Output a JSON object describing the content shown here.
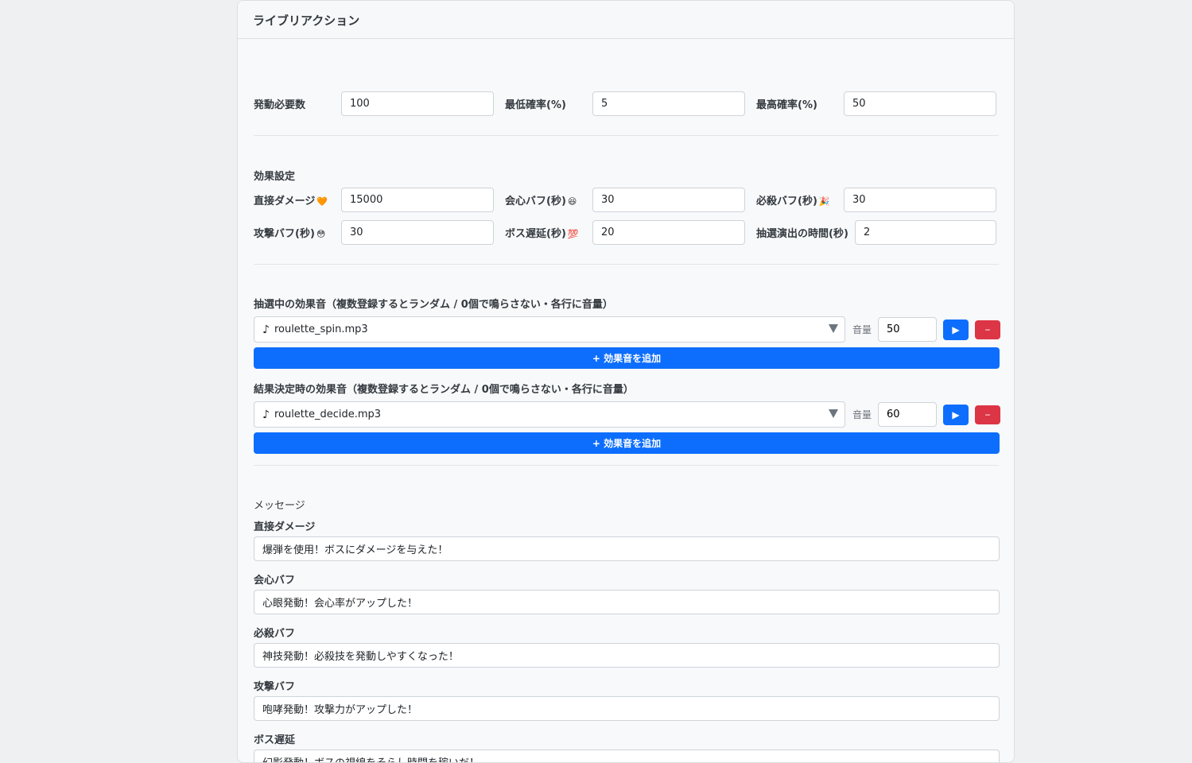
{
  "header": {
    "title": "ライブリアクション"
  },
  "trigger": {
    "required_label": "発動必要数",
    "required_value": "100",
    "min_label": "最低確率(%)",
    "min_value": "5",
    "max_label": "最高確率(%)",
    "max_value": "50"
  },
  "effects": {
    "title": "効果設定",
    "direct_damage_label": "直接ダメージ",
    "direct_damage_emoji": "🧡",
    "direct_damage_value": "15000",
    "crit_buff_label": "会心バフ(秒)",
    "crit_buff_emoji": "😆",
    "crit_buff_value": "30",
    "special_buff_label": "必殺バフ(秒)",
    "special_buff_emoji": "🎉",
    "special_buff_value": "30",
    "attack_buff_label": "攻撃バフ(秒)",
    "attack_buff_emoji": "😳",
    "attack_buff_value": "30",
    "boss_delay_label": "ボス遅延(秒)",
    "boss_delay_emoji": "💯",
    "boss_delay_value": "20",
    "draw_time_label": "抽選演出の時間(秒)",
    "draw_time_value": "2"
  },
  "sounds": {
    "spin_title": "抽選中の効果音（複数登録するとランダム / 0個で鳴らさない・各行に音量）",
    "spin_file": "roulette_spin.mp3",
    "spin_volume": "50",
    "decide_title": "結果決定時の効果音（複数登録するとランダム / 0個で鳴らさない・各行に音量）",
    "decide_file": "roulette_decide.mp3",
    "decide_volume": "60",
    "volume_label": "音量",
    "note_glyph": "♪",
    "play_glyph": "▶",
    "remove_glyph": "−",
    "add_label": "+ 効果音を追加"
  },
  "messages": {
    "title": "メッセージ",
    "direct_damage_label": "直接ダメージ",
    "direct_damage_text": "爆弾を使用！ボスにダメージを与えた！",
    "crit_buff_label": "会心バフ",
    "crit_buff_text": "心眼発動！会心率がアップした！",
    "special_buff_label": "必殺バフ",
    "special_buff_text": "神技発動！必殺技を発動しやすくなった！",
    "attack_buff_label": "攻撃バフ",
    "attack_buff_text": "咆哮発動！攻撃力がアップした！",
    "boss_delay_label": "ボス遅延",
    "boss_delay_text": "幻影発動！ボスの視線をそらし時間を稼いだ！"
  }
}
